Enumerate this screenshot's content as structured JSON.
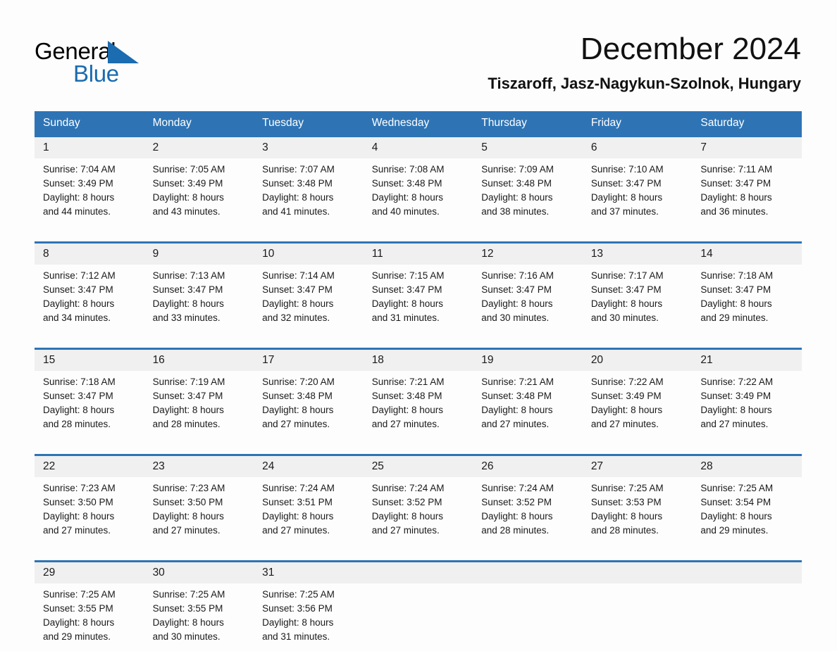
{
  "brand": {
    "name_part1": "General",
    "name_part2": "Blue",
    "triangle_color": "#1b6cb0"
  },
  "header": {
    "title": "December 2024",
    "subtitle": "Tiszaroff, Jasz-Nagykun-Szolnok, Hungary"
  },
  "colors": {
    "header_blue": "#2e74b5",
    "daynum_band": "#f0f0f0",
    "page_background": "#fdfdfd",
    "text": "#1a1a1a"
  },
  "weekday_headers": [
    "Sunday",
    "Monday",
    "Tuesday",
    "Wednesday",
    "Thursday",
    "Friday",
    "Saturday"
  ],
  "weeks": [
    {
      "days": [
        {
          "date": "1",
          "sunrise": "Sunrise: 7:04 AM",
          "sunset": "Sunset: 3:49 PM",
          "daylight_line1": "Daylight: 8 hours",
          "daylight_line2": "and 44 minutes."
        },
        {
          "date": "2",
          "sunrise": "Sunrise: 7:05 AM",
          "sunset": "Sunset: 3:49 PM",
          "daylight_line1": "Daylight: 8 hours",
          "daylight_line2": "and 43 minutes."
        },
        {
          "date": "3",
          "sunrise": "Sunrise: 7:07 AM",
          "sunset": "Sunset: 3:48 PM",
          "daylight_line1": "Daylight: 8 hours",
          "daylight_line2": "and 41 minutes."
        },
        {
          "date": "4",
          "sunrise": "Sunrise: 7:08 AM",
          "sunset": "Sunset: 3:48 PM",
          "daylight_line1": "Daylight: 8 hours",
          "daylight_line2": "and 40 minutes."
        },
        {
          "date": "5",
          "sunrise": "Sunrise: 7:09 AM",
          "sunset": "Sunset: 3:48 PM",
          "daylight_line1": "Daylight: 8 hours",
          "daylight_line2": "and 38 minutes."
        },
        {
          "date": "6",
          "sunrise": "Sunrise: 7:10 AM",
          "sunset": "Sunset: 3:47 PM",
          "daylight_line1": "Daylight: 8 hours",
          "daylight_line2": "and 37 minutes."
        },
        {
          "date": "7",
          "sunrise": "Sunrise: 7:11 AM",
          "sunset": "Sunset: 3:47 PM",
          "daylight_line1": "Daylight: 8 hours",
          "daylight_line2": "and 36 minutes."
        }
      ]
    },
    {
      "days": [
        {
          "date": "8",
          "sunrise": "Sunrise: 7:12 AM",
          "sunset": "Sunset: 3:47 PM",
          "daylight_line1": "Daylight: 8 hours",
          "daylight_line2": "and 34 minutes."
        },
        {
          "date": "9",
          "sunrise": "Sunrise: 7:13 AM",
          "sunset": "Sunset: 3:47 PM",
          "daylight_line1": "Daylight: 8 hours",
          "daylight_line2": "and 33 minutes."
        },
        {
          "date": "10",
          "sunrise": "Sunrise: 7:14 AM",
          "sunset": "Sunset: 3:47 PM",
          "daylight_line1": "Daylight: 8 hours",
          "daylight_line2": "and 32 minutes."
        },
        {
          "date": "11",
          "sunrise": "Sunrise: 7:15 AM",
          "sunset": "Sunset: 3:47 PM",
          "daylight_line1": "Daylight: 8 hours",
          "daylight_line2": "and 31 minutes."
        },
        {
          "date": "12",
          "sunrise": "Sunrise: 7:16 AM",
          "sunset": "Sunset: 3:47 PM",
          "daylight_line1": "Daylight: 8 hours",
          "daylight_line2": "and 30 minutes."
        },
        {
          "date": "13",
          "sunrise": "Sunrise: 7:17 AM",
          "sunset": "Sunset: 3:47 PM",
          "daylight_line1": "Daylight: 8 hours",
          "daylight_line2": "and 30 minutes."
        },
        {
          "date": "14",
          "sunrise": "Sunrise: 7:18 AM",
          "sunset": "Sunset: 3:47 PM",
          "daylight_line1": "Daylight: 8 hours",
          "daylight_line2": "and 29 minutes."
        }
      ]
    },
    {
      "days": [
        {
          "date": "15",
          "sunrise": "Sunrise: 7:18 AM",
          "sunset": "Sunset: 3:47 PM",
          "daylight_line1": "Daylight: 8 hours",
          "daylight_line2": "and 28 minutes."
        },
        {
          "date": "16",
          "sunrise": "Sunrise: 7:19 AM",
          "sunset": "Sunset: 3:47 PM",
          "daylight_line1": "Daylight: 8 hours",
          "daylight_line2": "and 28 minutes."
        },
        {
          "date": "17",
          "sunrise": "Sunrise: 7:20 AM",
          "sunset": "Sunset: 3:48 PM",
          "daylight_line1": "Daylight: 8 hours",
          "daylight_line2": "and 27 minutes."
        },
        {
          "date": "18",
          "sunrise": "Sunrise: 7:21 AM",
          "sunset": "Sunset: 3:48 PM",
          "daylight_line1": "Daylight: 8 hours",
          "daylight_line2": "and 27 minutes."
        },
        {
          "date": "19",
          "sunrise": "Sunrise: 7:21 AM",
          "sunset": "Sunset: 3:48 PM",
          "daylight_line1": "Daylight: 8 hours",
          "daylight_line2": "and 27 minutes."
        },
        {
          "date": "20",
          "sunrise": "Sunrise: 7:22 AM",
          "sunset": "Sunset: 3:49 PM",
          "daylight_line1": "Daylight: 8 hours",
          "daylight_line2": "and 27 minutes."
        },
        {
          "date": "21",
          "sunrise": "Sunrise: 7:22 AM",
          "sunset": "Sunset: 3:49 PM",
          "daylight_line1": "Daylight: 8 hours",
          "daylight_line2": "and 27 minutes."
        }
      ]
    },
    {
      "days": [
        {
          "date": "22",
          "sunrise": "Sunrise: 7:23 AM",
          "sunset": "Sunset: 3:50 PM",
          "daylight_line1": "Daylight: 8 hours",
          "daylight_line2": "and 27 minutes."
        },
        {
          "date": "23",
          "sunrise": "Sunrise: 7:23 AM",
          "sunset": "Sunset: 3:50 PM",
          "daylight_line1": "Daylight: 8 hours",
          "daylight_line2": "and 27 minutes."
        },
        {
          "date": "24",
          "sunrise": "Sunrise: 7:24 AM",
          "sunset": "Sunset: 3:51 PM",
          "daylight_line1": "Daylight: 8 hours",
          "daylight_line2": "and 27 minutes."
        },
        {
          "date": "25",
          "sunrise": "Sunrise: 7:24 AM",
          "sunset": "Sunset: 3:52 PM",
          "daylight_line1": "Daylight: 8 hours",
          "daylight_line2": "and 27 minutes."
        },
        {
          "date": "26",
          "sunrise": "Sunrise: 7:24 AM",
          "sunset": "Sunset: 3:52 PM",
          "daylight_line1": "Daylight: 8 hours",
          "daylight_line2": "and 28 minutes."
        },
        {
          "date": "27",
          "sunrise": "Sunrise: 7:25 AM",
          "sunset": "Sunset: 3:53 PM",
          "daylight_line1": "Daylight: 8 hours",
          "daylight_line2": "and 28 minutes."
        },
        {
          "date": "28",
          "sunrise": "Sunrise: 7:25 AM",
          "sunset": "Sunset: 3:54 PM",
          "daylight_line1": "Daylight: 8 hours",
          "daylight_line2": "and 29 minutes."
        }
      ]
    },
    {
      "days": [
        {
          "date": "29",
          "sunrise": "Sunrise: 7:25 AM",
          "sunset": "Sunset: 3:55 PM",
          "daylight_line1": "Daylight: 8 hours",
          "daylight_line2": "and 29 minutes."
        },
        {
          "date": "30",
          "sunrise": "Sunrise: 7:25 AM",
          "sunset": "Sunset: 3:55 PM",
          "daylight_line1": "Daylight: 8 hours",
          "daylight_line2": "and 30 minutes."
        },
        {
          "date": "31",
          "sunrise": "Sunrise: 7:25 AM",
          "sunset": "Sunset: 3:56 PM",
          "daylight_line1": "Daylight: 8 hours",
          "daylight_line2": "and 31 minutes."
        },
        {
          "date": "",
          "sunrise": "",
          "sunset": "",
          "daylight_line1": "",
          "daylight_line2": ""
        },
        {
          "date": "",
          "sunrise": "",
          "sunset": "",
          "daylight_line1": "",
          "daylight_line2": ""
        },
        {
          "date": "",
          "sunrise": "",
          "sunset": "",
          "daylight_line1": "",
          "daylight_line2": ""
        },
        {
          "date": "",
          "sunrise": "",
          "sunset": "",
          "daylight_line1": "",
          "daylight_line2": ""
        }
      ]
    }
  ]
}
